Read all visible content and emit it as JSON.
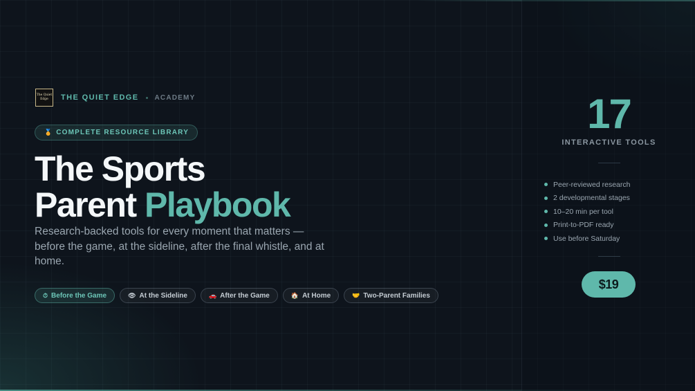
{
  "brand": {
    "logo_text_line1": "The Quiet",
    "logo_text_line2": "Edge",
    "name": "THE QUIET EDGE",
    "sub": "ACADEMY"
  },
  "badge": {
    "icon": "medal-icon",
    "label": "COMPLETE RESOURCE LIBRARY"
  },
  "hero": {
    "title_line1": "The Sports",
    "title_line2_plain": "Parent",
    "title_line2_accent": "Playbook",
    "subtitle": "Research-backed tools for every moment that matters — before the game, at the sideline, after the final whistle, and at home."
  },
  "chips": [
    {
      "icon": "timer-icon",
      "glyph": "⏱",
      "label": "Before the Game",
      "active": true
    },
    {
      "icon": "eye-icon",
      "glyph": "👁",
      "label": "At the Sideline",
      "active": false
    },
    {
      "icon": "car-icon",
      "glyph": "🚗",
      "label": "After the Game",
      "active": false
    },
    {
      "icon": "home-icon",
      "glyph": "🏠",
      "label": "At Home",
      "active": false
    },
    {
      "icon": "handshake-icon",
      "glyph": "🤝",
      "label": "Two-Parent Families",
      "active": false
    }
  ],
  "panel": {
    "stat_value": "17",
    "stat_label": "INTERACTIVE TOOLS",
    "features": [
      "Peer-reviewed research",
      "2 developmental stages",
      "10–20 min per tool",
      "Print-to-PDF ready",
      "Use before Saturday"
    ],
    "price": "$19"
  },
  "colors": {
    "accent": "#5fb8ab",
    "background": "#0e141c"
  }
}
